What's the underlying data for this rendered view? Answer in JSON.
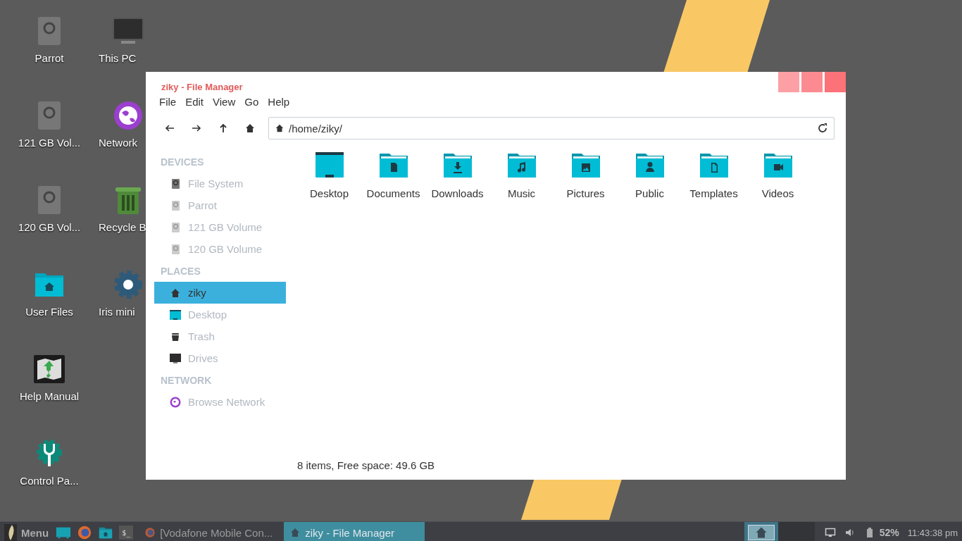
{
  "desktop_icons": [
    {
      "label": "Parrot",
      "kind": "drive"
    },
    {
      "label": "121 GB Vol...",
      "kind": "drive"
    },
    {
      "label": "120 GB Vol...",
      "kind": "drive"
    },
    {
      "label": "User Files",
      "kind": "home-folder"
    },
    {
      "label": "Help Manual",
      "kind": "map"
    },
    {
      "label": "Control Pa...",
      "kind": "control"
    },
    {
      "label": "This PC",
      "kind": "monitor"
    },
    {
      "label": "Network",
      "kind": "globe"
    },
    {
      "label": "Recycle B",
      "kind": "trash"
    },
    {
      "label": "Iris mini",
      "kind": "gear"
    }
  ],
  "window": {
    "title": "ziky - File Manager",
    "menu": [
      "File",
      "Edit",
      "View",
      "Go",
      "Help"
    ],
    "location": "/home/ziky/",
    "sidebar": [
      {
        "title": "DEVICES",
        "items": [
          {
            "label": "File System",
            "kind": "drive-dark",
            "selected": false
          },
          {
            "label": "Parrot",
            "kind": "drive",
            "selected": false
          },
          {
            "label": "121 GB Volume",
            "kind": "drive",
            "selected": false
          },
          {
            "label": "120 GB Volume",
            "kind": "drive",
            "selected": false
          }
        ]
      },
      {
        "title": "PLACES",
        "items": [
          {
            "label": "ziky",
            "kind": "home",
            "selected": true
          },
          {
            "label": "Desktop",
            "kind": "desktop",
            "selected": false
          },
          {
            "label": "Trash",
            "kind": "trash",
            "selected": false
          },
          {
            "label": "Drives",
            "kind": "monitor",
            "selected": false
          }
        ]
      },
      {
        "title": "NETWORK",
        "items": [
          {
            "label": "Browse Network",
            "kind": "globe",
            "selected": false
          }
        ]
      }
    ],
    "files": [
      {
        "label": "Desktop",
        "kind": "desktop"
      },
      {
        "label": "Documents",
        "kind": "document"
      },
      {
        "label": "Downloads",
        "kind": "download"
      },
      {
        "label": "Music",
        "kind": "music"
      },
      {
        "label": "Pictures",
        "kind": "picture"
      },
      {
        "label": "Public",
        "kind": "person"
      },
      {
        "label": "Templates",
        "kind": "template"
      },
      {
        "label": "Videos",
        "kind": "video"
      }
    ],
    "status": "8 items, Free space: 49.6 GB"
  },
  "taskbar": {
    "menu": "Menu",
    "terminal": "$_",
    "tasks": [
      {
        "label": "[Vodafone Mobile Con...",
        "kind": "browser",
        "selected": false
      },
      {
        "label": "ziky - File Manager",
        "kind": "home",
        "selected": true
      }
    ],
    "battery": "52%",
    "clock": "11:43:38 pm"
  }
}
